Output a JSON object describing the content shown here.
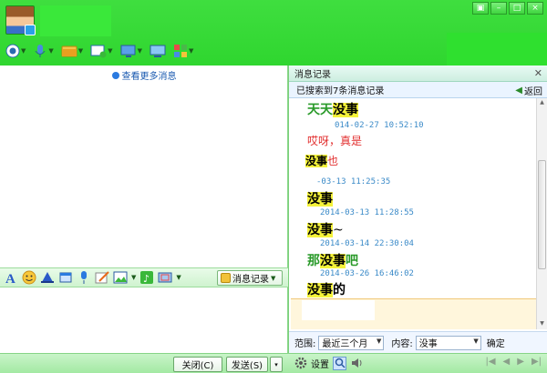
{
  "header": {
    "window_controls": {
      "menu": "▣",
      "minimize": "–",
      "maximize": "□",
      "close": "×"
    },
    "toolbar_icons": [
      "video-icon",
      "microphone-icon",
      "folder-icon",
      "app-add-icon",
      "screen-share-icon",
      "remote-desktop-icon",
      "apps-grid-icon"
    ]
  },
  "chat": {
    "view_more": "查看更多消息"
  },
  "input_toolbar": {
    "icons": [
      "font-icon",
      "emoji-icon",
      "hat-icon",
      "window-shake-icon",
      "voice-message-icon",
      "handwriting-icon",
      "image-icon",
      "music-icon",
      "screenshot-icon"
    ],
    "history_label": "消息记录"
  },
  "bottom": {
    "close_label": "关闭(C)",
    "send_label": "发送(S)",
    "send_dropdown": "▾"
  },
  "history_panel": {
    "title": "消息记录",
    "close_glyph": "✕",
    "search_result": "已搜索到7条消息记录",
    "back_label": "返回",
    "messages": [
      {
        "prefix": "天天",
        "keyword": "没事",
        "suffix": "",
        "color": "green"
      },
      {
        "timestamp": "014-02-27 10:52:10"
      },
      {
        "prefix": "哎呀，真是",
        "keyword": "",
        "suffix": "",
        "color": "red"
      },
      {
        "prefix": "",
        "keyword": "没事",
        "suffix": "也",
        "color": "red"
      },
      {
        "timestamp": "-03-13 11:25:35"
      },
      {
        "prefix": "",
        "keyword": "没事",
        "suffix": "",
        "color": "black"
      },
      {
        "timestamp": "2014-03-13 11:28:55"
      },
      {
        "prefix": "",
        "keyword": "没事",
        "suffix": "~",
        "color": "black"
      },
      {
        "timestamp": "2014-03-14 22:30:04"
      },
      {
        "prefix": "那",
        "keyword": "没事",
        "suffix": "吧",
        "color": "green"
      },
      {
        "timestamp": "2014-03-26 16:46:02"
      },
      {
        "prefix": "",
        "keyword": "没事",
        "suffix": "的",
        "color": "black"
      }
    ],
    "range_label": "范围:",
    "range_value": "最近三个月",
    "content_label": "内容:",
    "content_value": "没事",
    "confirm_label": "确定",
    "settings_label": "设置",
    "pager": [
      "|◀",
      "◀",
      "▶",
      "▶|"
    ]
  },
  "colors": {
    "brand_green": "#3fde3f",
    "highlight": "#f5f33a",
    "timestamp_blue": "#3a8ac8"
  }
}
